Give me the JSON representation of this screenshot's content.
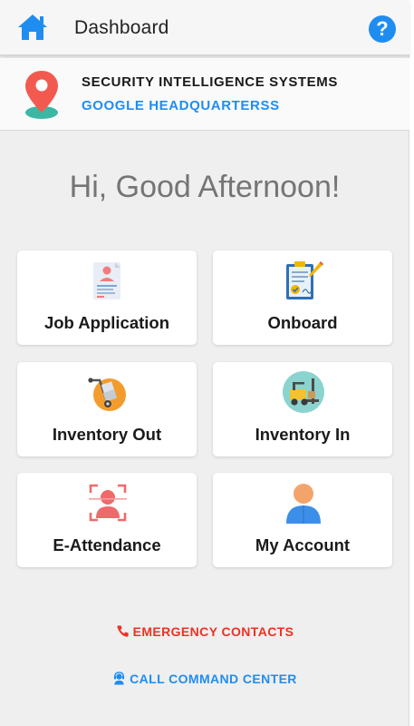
{
  "header": {
    "title": "Dashboard",
    "home_icon": "home-icon",
    "help_icon": "help-icon",
    "help_glyph": "?",
    "accent": "#1f8df0"
  },
  "site": {
    "company": "SECURITY INTELLIGENCE SYSTEMS",
    "location": "GOOGLE HEADQUARTERSS",
    "icon": "location-pin-icon"
  },
  "greeting": "Hi, Good Afternoon!",
  "tiles": [
    {
      "label": "Job Application",
      "icon": "resume-document-icon"
    },
    {
      "label": "Onboard",
      "icon": "clipboard-sign-icon"
    },
    {
      "label": "Inventory Out",
      "icon": "hand-truck-icon"
    },
    {
      "label": "Inventory In",
      "icon": "forklift-icon"
    },
    {
      "label": "E-Attendance",
      "icon": "face-scan-icon"
    },
    {
      "label": "My Account",
      "icon": "user-avatar-icon"
    }
  ],
  "footer": {
    "emergency_label": "EMERGENCY CONTACTS",
    "emergency_color": "#ee3124",
    "command_label": "CALL COMMAND CENTER",
    "command_color": "#1f8df0"
  }
}
